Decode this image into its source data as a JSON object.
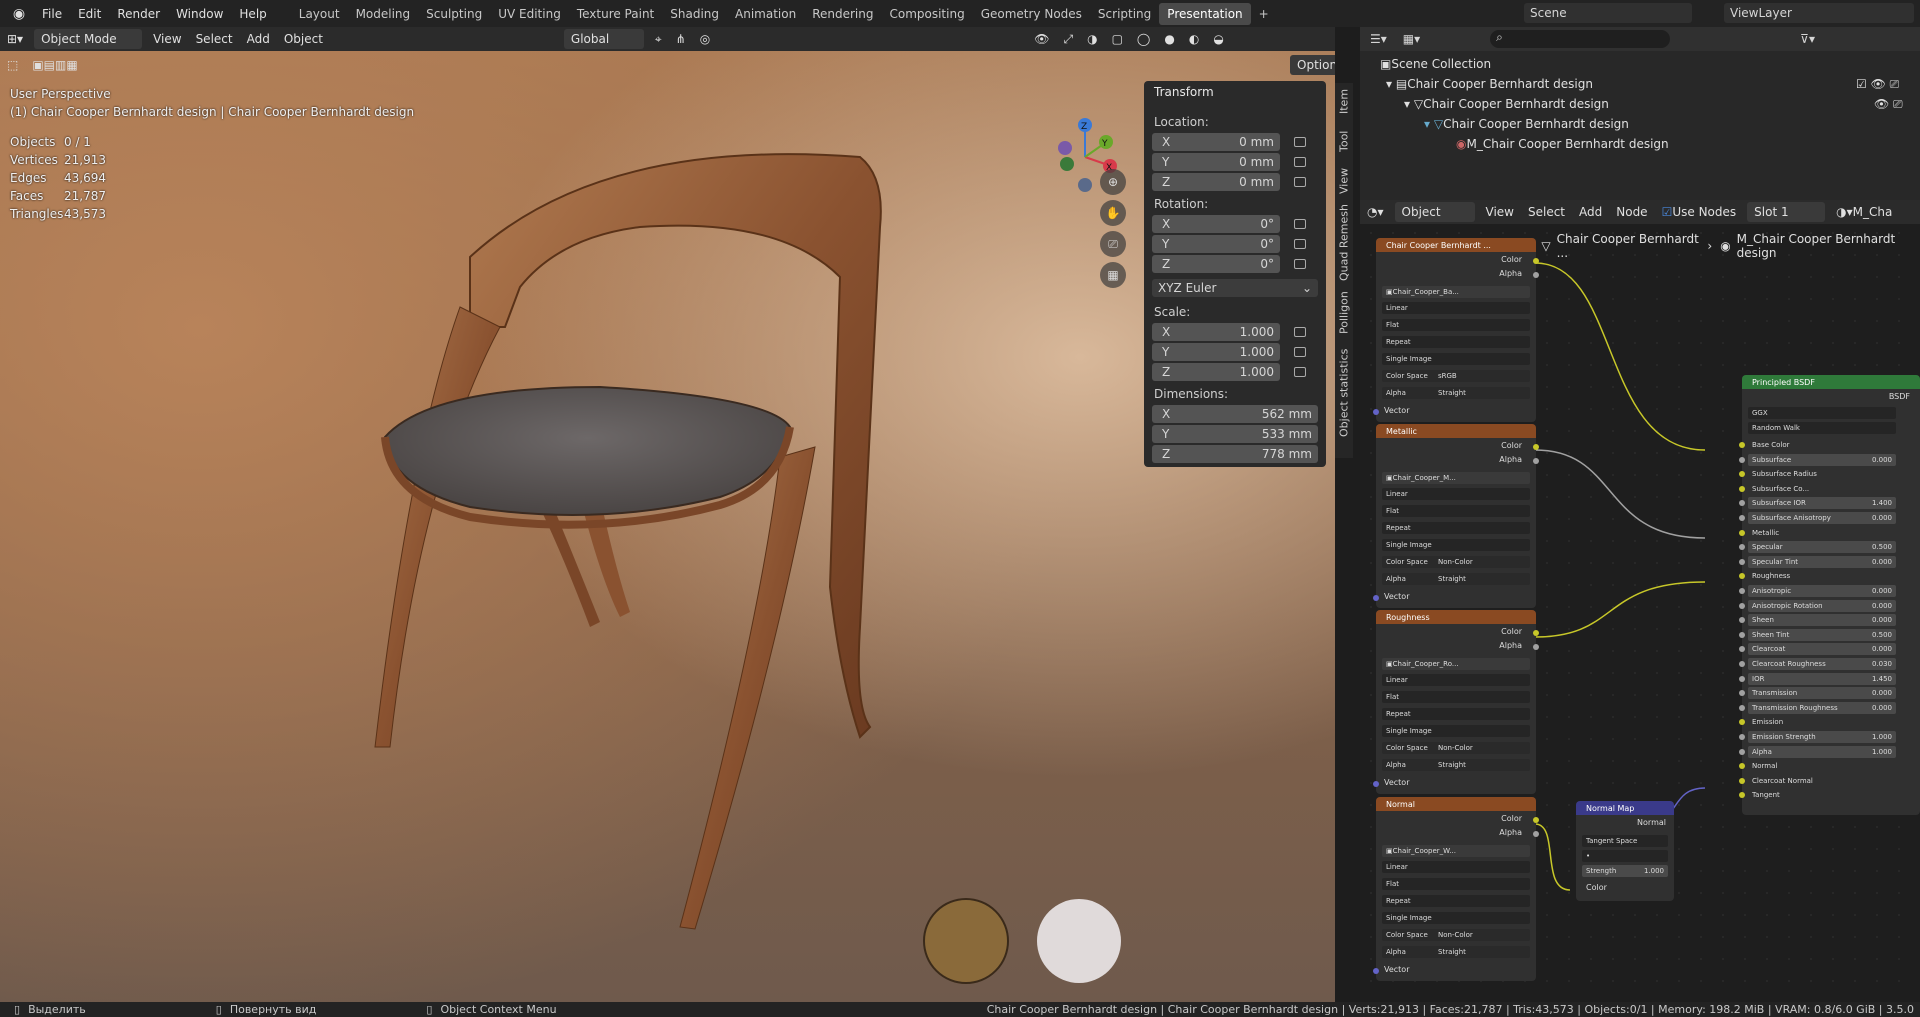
{
  "topbar": {
    "menus": [
      "File",
      "Edit",
      "Render",
      "Window",
      "Help"
    ],
    "workspaces": [
      "Layout",
      "Modeling",
      "Sculpting",
      "UV Editing",
      "Texture Paint",
      "Shading",
      "Animation",
      "Rendering",
      "Compositing",
      "Geometry Nodes",
      "Scripting",
      "Presentation"
    ],
    "active_workspace": "Presentation",
    "scene": "Scene",
    "viewlayer": "ViewLayer"
  },
  "viewport": {
    "mode": "Object Mode",
    "menus": [
      "View",
      "Select",
      "Add",
      "Object"
    ],
    "orientation": "Global",
    "options": "Options",
    "perspective": "User Perspective",
    "active_object": "(1) Chair Cooper Bernhardt design | Chair Cooper Bernhardt design",
    "stats": [
      {
        "k": "Objects",
        "v": "0 / 1"
      },
      {
        "k": "Vertices",
        "v": "21,913"
      },
      {
        "k": "Edges",
        "v": "43,694"
      },
      {
        "k": "Faces",
        "v": "21,787"
      },
      {
        "k": "Triangles",
        "v": "43,573"
      }
    ],
    "gizmo": {
      "x": "X",
      "y": "Y",
      "z": "Z"
    }
  },
  "npanel": {
    "title": "Transform",
    "location_label": "Location:",
    "location": [
      "0 mm",
      "0 mm",
      "0 mm"
    ],
    "rotation_label": "Rotation:",
    "rotation": [
      "0°",
      "0°",
      "0°"
    ],
    "rotation_mode": "XYZ Euler",
    "scale_label": "Scale:",
    "scale": [
      "1.000",
      "1.000",
      "1.000"
    ],
    "dimensions_label": "Dimensions:",
    "dimensions": [
      "562 mm",
      "533 mm",
      "778 mm"
    ],
    "axes": [
      "X",
      "Y",
      "Z"
    ],
    "tabs": [
      "Item",
      "Tool",
      "View",
      "Quad Remesh",
      "Polligon",
      "Object statistics"
    ]
  },
  "outliner": {
    "items": [
      "Scene Collection",
      "Chair Cooper Bernhardt design",
      "Chair Cooper Bernhardt design",
      "Chair Cooper Bernhardt design",
      "M_Chair Cooper Bernhardt design"
    ]
  },
  "node_editor": {
    "mode": "Object",
    "menus": [
      "View",
      "Select",
      "Add",
      "Node"
    ],
    "use_nodes": "Use Nodes",
    "slot": "Slot 1",
    "material": "M_Cha",
    "breadcrumb": [
      "Chair Cooper Bernhardt ...",
      "Chair Cooper Bernhardt ...",
      "M_Chair Cooper Bernhardt design"
    ],
    "tex_nodes": [
      {
        "title": "Chair Cooper Bernhardt ...",
        "image": "Chair_Cooper_Ba...",
        "colorspace": "sRGB",
        "alpha": "Straight"
      },
      {
        "title": "Metallic",
        "image": "Chair_Cooper_M...",
        "colorspace": "Non-Color",
        "alpha": "Straight"
      },
      {
        "title": "Roughness",
        "image": "Chair_Cooper_Ro...",
        "colorspace": "Non-Color",
        "alpha": "Straight"
      },
      {
        "title": "Normal",
        "image": "Chair_Cooper_W...",
        "colorspace": "Non-Color",
        "alpha": "Straight"
      }
    ],
    "tex_options": [
      "Linear",
      "Flat",
      "Repeat",
      "Single Image"
    ],
    "tex_labels": {
      "color": "Color",
      "alpha": "Alpha",
      "vector": "Vector",
      "colorspace": "Color Space",
      "alpha_mode": "Alpha"
    },
    "normal_map": {
      "title": "Normal Map",
      "out": "Normal",
      "space": "Tangent Space",
      "strength_label": "Strength",
      "strength": "1.000",
      "in": "Color"
    },
    "bsdf": {
      "title": "Principled BSDF",
      "out": "BSDF",
      "dist": "GGX",
      "sss": "Random Walk",
      "rows": [
        {
          "l": "Base Color",
          "v": ""
        },
        {
          "l": "Subsurface",
          "v": "0.000"
        },
        {
          "l": "Subsurface Radius",
          "v": ""
        },
        {
          "l": "Subsurface Co...",
          "v": ""
        },
        {
          "l": "Subsurface IOR",
          "v": "1.400"
        },
        {
          "l": "Subsurface Anisotropy",
          "v": "0.000"
        },
        {
          "l": "Metallic",
          "v": ""
        },
        {
          "l": "Specular",
          "v": "0.500"
        },
        {
          "l": "Specular Tint",
          "v": "0.000"
        },
        {
          "l": "Roughness",
          "v": ""
        },
        {
          "l": "Anisotropic",
          "v": "0.000"
        },
        {
          "l": "Anisotropic Rotation",
          "v": "0.000"
        },
        {
          "l": "Sheen",
          "v": "0.000"
        },
        {
          "l": "Sheen Tint",
          "v": "0.500"
        },
        {
          "l": "Clearcoat",
          "v": "0.000"
        },
        {
          "l": "Clearcoat Roughness",
          "v": "0.030"
        },
        {
          "l": "IOR",
          "v": "1.450"
        },
        {
          "l": "Transmission",
          "v": "0.000"
        },
        {
          "l": "Transmission Roughness",
          "v": "0.000"
        },
        {
          "l": "Emission",
          "v": ""
        },
        {
          "l": "Emission Strength",
          "v": "1.000"
        },
        {
          "l": "Alpha",
          "v": "1.000"
        },
        {
          "l": "Normal",
          "v": ""
        },
        {
          "l": "Clearcoat Normal",
          "v": ""
        },
        {
          "l": "Tangent",
          "v": ""
        }
      ]
    }
  },
  "status": {
    "select": "Выделить",
    "rotate": "Повернуть вид",
    "context": "Object Context Menu",
    "info": "Chair Cooper Bernhardt design | Chair Cooper Bernhardt design | Verts:21,913 | Faces:21,787 | Tris:43,573 | Objects:0/1 | Memory: 198.2 MiB | VRAM: 0.8/6.0 GiB | 3.5.0"
  },
  "colors": {
    "tex_header": "#8a4a22",
    "bsdf_header": "#2f7a3a",
    "normal_header": "#3a3a8a",
    "yellow_socket": "#c7c729",
    "grey_socket": "#a1a1a1",
    "purple_socket": "#6363c7"
  }
}
